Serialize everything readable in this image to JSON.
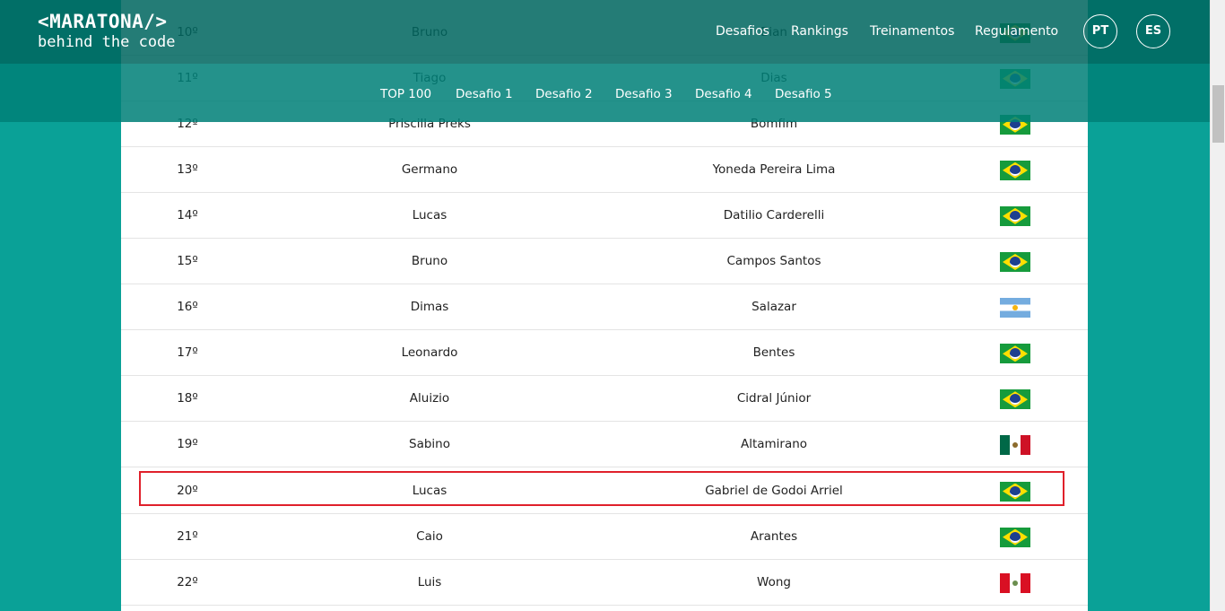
{
  "header": {
    "logo_main": "<MARATONA/>",
    "logo_sub": "behind the code",
    "nav": [
      "Desafios",
      "Rankings",
      "Treinamentos",
      "Regulamento"
    ],
    "languages": [
      "PT",
      "ES"
    ]
  },
  "tabs": [
    "TOP 100",
    "Desafio 1",
    "Desafio 2",
    "Desafio 3",
    "Desafio 4",
    "Desafio 5"
  ],
  "ranking": [
    {
      "rank": "10º",
      "first": "Bruno",
      "last": "Bian",
      "flag": "brazil-flag-icon"
    },
    {
      "rank": "11º",
      "first": "Tiago",
      "last": "Dias",
      "flag": "brazil-flag-icon"
    },
    {
      "rank": "12º",
      "first": "Priscilla Preks",
      "last": "Bomfim",
      "flag": "brazil-flag-icon"
    },
    {
      "rank": "13º",
      "first": "Germano",
      "last": "Yoneda Pereira Lima",
      "flag": "brazil-flag-icon"
    },
    {
      "rank": "14º",
      "first": "Lucas",
      "last": "Datilio Carderelli",
      "flag": "brazil-flag-icon"
    },
    {
      "rank": "15º",
      "first": "Bruno",
      "last": "Campos Santos",
      "flag": "brazil-flag-icon"
    },
    {
      "rank": "16º",
      "first": "Dimas",
      "last": "Salazar",
      "flag": "argentina-flag-icon"
    },
    {
      "rank": "17º",
      "first": "Leonardo",
      "last": "Bentes",
      "flag": "brazil-flag-icon"
    },
    {
      "rank": "18º",
      "first": "Aluizio",
      "last": "Cidral Júnior",
      "flag": "brazil-flag-icon"
    },
    {
      "rank": "19º",
      "first": "Sabino",
      "last": "Altamirano",
      "flag": "mexico-flag-icon"
    },
    {
      "rank": "20º",
      "first": "Lucas",
      "last": "Gabriel de Godoi Arriel",
      "flag": "brazil-flag-icon"
    },
    {
      "rank": "21º",
      "first": "Caio",
      "last": "Arantes",
      "flag": "brazil-flag-icon"
    },
    {
      "rank": "22º",
      "first": "Luis",
      "last": "Wong",
      "flag": "peru-flag-icon"
    }
  ],
  "highlighted_rank": "20º",
  "colors": {
    "page_background": "#0aa197",
    "header_top": "#006660",
    "header_tabs": "#008078",
    "highlight": "#e0202b"
  }
}
